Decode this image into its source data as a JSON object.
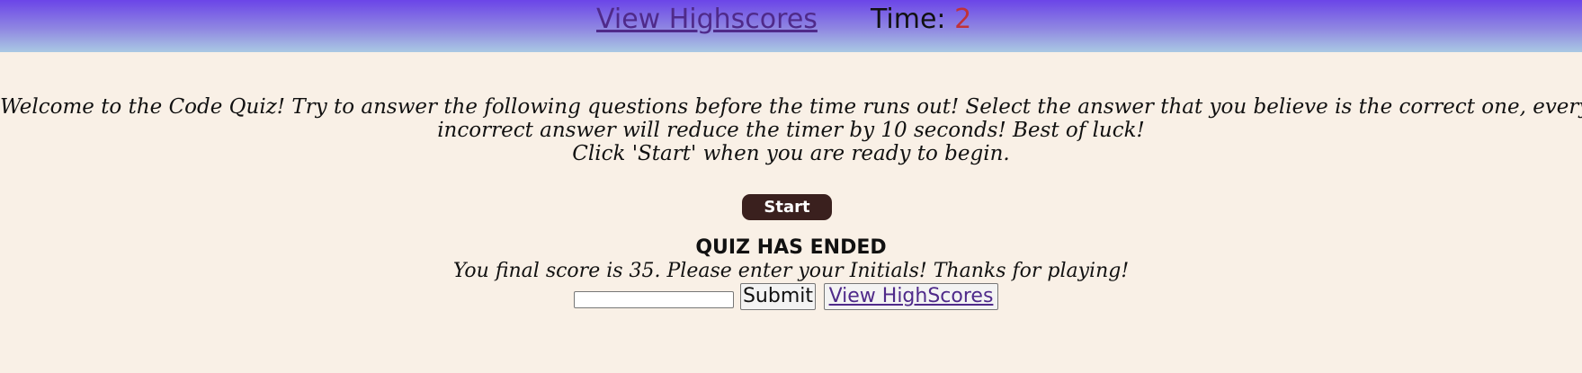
{
  "header": {
    "highscores_link": "View Highscores",
    "timer_label": "Time:",
    "timer_value": "2"
  },
  "intro": {
    "line1": "Welcome to the Code Quiz! Try to answer the following questions before the time runs out! Select the answer that you believe is the correct one, every",
    "line2": "incorrect answer will reduce the timer by 10 seconds! Best of luck!",
    "line3": "Click 'Start' when you are ready to begin."
  },
  "start_button": "Start",
  "end": {
    "title": "QUIZ HAS ENDED",
    "message": "You final score is 35. Please enter your Initials! Thanks for playing!",
    "initials_value": "",
    "submit_label": "Submit",
    "view_highscores_label": "View HighScores"
  },
  "colors": {
    "background": "#f9f0e6",
    "header_top": "#6b45e8",
    "header_bottom": "#a9c9e3",
    "start_button": "#3a201e",
    "timer_value": "#c0323a",
    "link": "#4f2a8a"
  }
}
